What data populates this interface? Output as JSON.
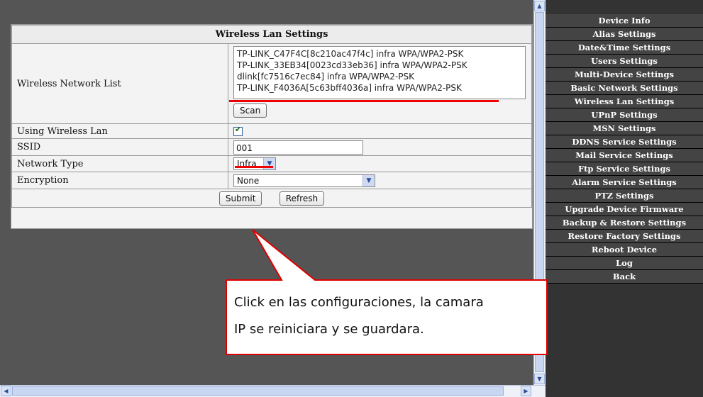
{
  "panel": {
    "title": "Wireless Lan Settings",
    "network_list_label": "Wireless Network List",
    "networks": [
      "TP-LINK_C47F4C[8c210ac47f4c] infra WPA/WPA2-PSK",
      "TP-LINK_33EB34[0023cd33eb36] infra WPA/WPA2-PSK",
      "dlink[fc7516c7ec84] infra WPA/WPA2-PSK",
      "TP-LINK_F4036A[5c63bff4036a] infra WPA/WPA2-PSK"
    ],
    "scan_label": "Scan",
    "using_wireless_label": "Using Wireless Lan",
    "using_wireless_checked": true,
    "ssid_label": "SSID",
    "ssid_value": "001",
    "network_type_label": "Network Type",
    "network_type_value": "Infra",
    "encryption_label": "Encryption",
    "encryption_value": "None",
    "submit_label": "Submit",
    "refresh_label": "Refresh"
  },
  "menu": {
    "items": [
      "Device Info",
      "Alias Settings",
      "Date&Time Settings",
      "Users Settings",
      "Multi-Device Settings",
      "Basic Network Settings",
      "Wireless Lan Settings",
      "UPnP Settings",
      "MSN Settings",
      "DDNS Service Settings",
      "Mail Service Settings",
      "Ftp Service Settings",
      "Alarm Service Settings",
      "PTZ Settings",
      "Upgrade Device Firmware",
      "Backup & Restore Settings",
      "Restore Factory Settings",
      "Reboot Device",
      "Log",
      "Back"
    ]
  },
  "callout": {
    "line1": "Click en las configuraciones, la camara",
    "line2": "IP se reiniciara y se guardara."
  },
  "colors": {
    "annotation_red": "#e00000",
    "menu_bg": "#444444"
  }
}
